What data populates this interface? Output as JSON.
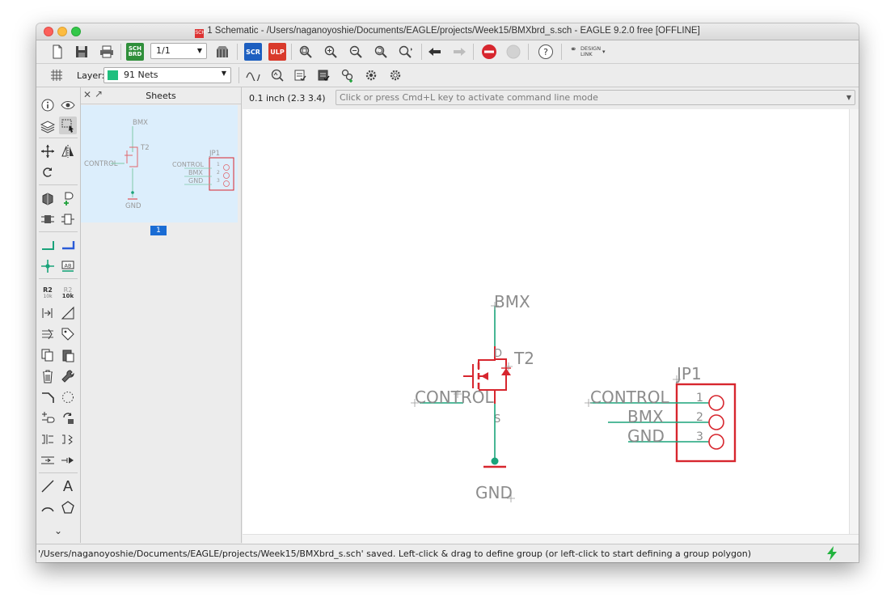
{
  "window": {
    "title": "1 Schematic - /Users/naganoyoshie/Documents/EAGLE/projects/Week15/BMXbrd_s.sch - EAGLE 9.2.0 free [OFFLINE]",
    "title_icon": "SCH"
  },
  "toolbar": {
    "sheet_selector": "1/1",
    "sch_brd_label": "SCH BRD",
    "scr_label": "SCR",
    "ulp_label": "ULP",
    "design_link_label": "DESIGN LINK",
    "help_label": "?"
  },
  "layer_bar": {
    "label": "Layer:",
    "selected_layer": "91 Nets",
    "layer_color": "#1fbf7e"
  },
  "sheets_panel": {
    "title": "Sheets",
    "sheet_number": "1",
    "thumb": {
      "bmx": "BMX",
      "t2": "T2",
      "control": "CONTROL",
      "gnd": "GND",
      "jp1": "JP1",
      "jp_control": "CONTROL",
      "jp_bmx": "BMX",
      "jp_gnd": "GND",
      "pin1": "1",
      "pin2": "2",
      "pin3": "3"
    }
  },
  "coord_bar": {
    "grid_position": "0.1 inch (2.3 3.4)",
    "command_placeholder": "Click or press Cmd+L key to activate command line mode"
  },
  "schematic": {
    "bmx_label": "BMX",
    "gnd_label": "GND",
    "control_label": "CONTROL",
    "transistor_name": "T2",
    "drain_label": "D",
    "source_label": "S",
    "connector_name": "JP1",
    "connector_pins": [
      {
        "number": "1",
        "net": "CONTROL"
      },
      {
        "number": "2",
        "net": "BMX"
      },
      {
        "number": "3",
        "net": "GND"
      }
    ],
    "net_color": "#1aa37a",
    "part_color": "#d7262e",
    "label_color": "#8c8c8c"
  },
  "status": {
    "message": "'/Users/naganoyoshie/Documents/EAGLE/projects/Week15/BMXbrd_s.sch' saved. Left-click & drag to define group (or left-click to start defining a group polygon)"
  }
}
